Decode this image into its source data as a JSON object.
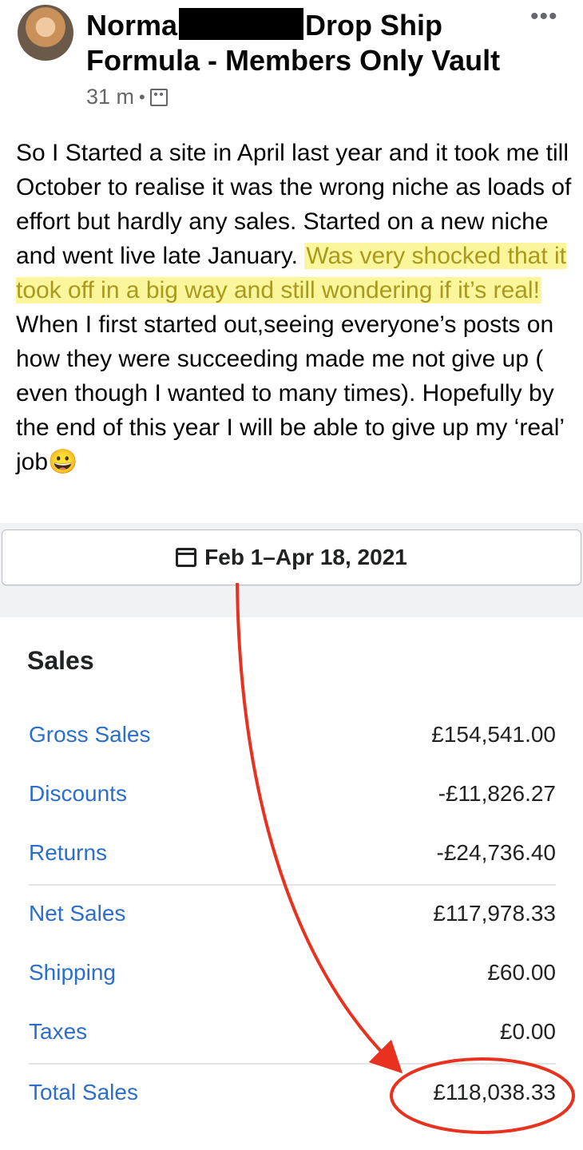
{
  "post": {
    "author_first": "Norma",
    "group_suffix": "Drop Ship",
    "group_line2": "Formula - Members Only Vault",
    "timestamp": "31 m",
    "separator": "•",
    "more_label": "•••",
    "body_part1": "So I Started a site in April last year and it took me till October to realise it was the wrong niche as loads of effort but hardly any sales. Started on a new niche and went live late January. ",
    "body_highlight": "Was very shocked that it took off in a big way and still wondering if it’s real!",
    "body_part2": " When I first started out,seeing everyone’s posts on how they were succeeding made me not give up ( even though I wanted to many times). Hopefully by the end of this year I will be able to give up my ‘real’ job",
    "emoji": "😀"
  },
  "report": {
    "date_range": "Feb 1–Apr 18, 2021",
    "card_title": "Sales",
    "rows": [
      {
        "label": "Gross Sales",
        "value": "£154,541.00"
      },
      {
        "label": "Discounts",
        "value": "-£11,826.27"
      },
      {
        "label": "Returns",
        "value": "-£24,736.40"
      },
      {
        "label": "Net Sales",
        "value": "£117,978.33"
      },
      {
        "label": "Shipping",
        "value": "£60.00"
      },
      {
        "label": "Taxes",
        "value": "£0.00"
      },
      {
        "label": "Total Sales",
        "value": "£118,038.33"
      }
    ]
  },
  "colors": {
    "highlight_bg": "#fbf59b",
    "link_blue": "#2c6ecb",
    "annotation_red": "#e8321f"
  },
  "icons": {
    "audience": "group-members-icon",
    "calendar": "calendar-icon",
    "more": "more-options-icon"
  }
}
